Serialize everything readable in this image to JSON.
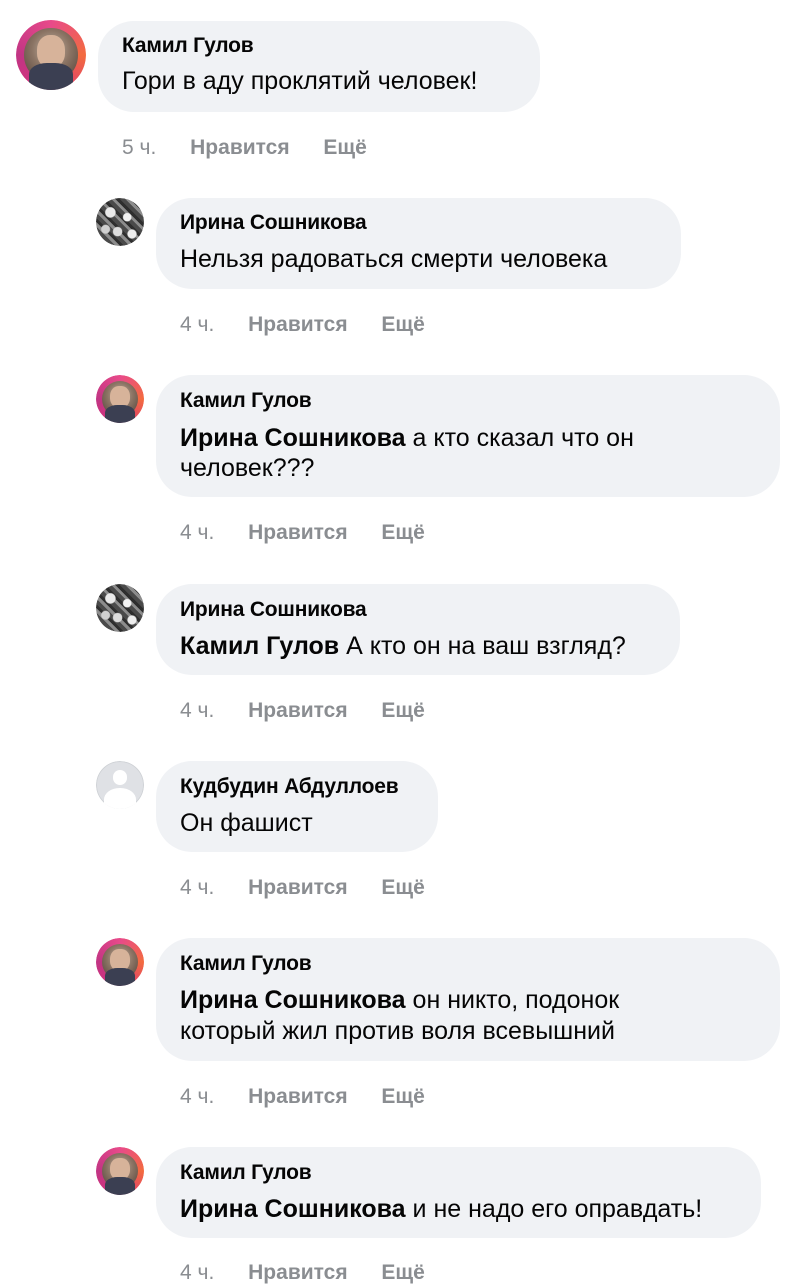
{
  "comments": [
    {
      "author": "Камил Гулов",
      "mention": "",
      "text": "Гори в аду проклятий человек!",
      "time": "5 ч.",
      "like": "Нравится",
      "more": "Ещё",
      "avatar": "kamil-avatar"
    },
    {
      "author": "Ирина Сошникова",
      "mention": "",
      "text": "Нельзя радоваться смерти человека",
      "time": "4 ч.",
      "like": "Нравится",
      "more": "Ещё",
      "avatar": "irina-avatar"
    },
    {
      "author": "Камил Гулов",
      "mention": "Ирина Сошникова",
      "text": " а кто сказал что он",
      "text2": "человек???",
      "time": "4 ч.",
      "like": "Нравится",
      "more": "Ещё",
      "avatar": "kamil-avatar"
    },
    {
      "author": "Ирина Сошникова",
      "mention": "Камил Гулов",
      "text": " А кто он на ваш взгляд?",
      "time": "4 ч.",
      "like": "Нравится",
      "more": "Ещё",
      "avatar": "irina-avatar"
    },
    {
      "author": "Кудбудин Абдуллоев",
      "mention": "",
      "text": "Он фашист",
      "time": "4 ч.",
      "like": "Нравится",
      "more": "Ещё",
      "avatar": "default-avatar"
    },
    {
      "author": "Камил Гулов",
      "mention": "Ирина Сошникова",
      "text": " он никто, подонок",
      "text2": "который жил против воля всевышний",
      "time": "4 ч.",
      "like": "Нравится",
      "more": "Ещё",
      "avatar": "kamil-avatar"
    },
    {
      "author": "Камил Гулов",
      "mention": "Ирина Сошникова",
      "text": " и не надо его оправдать!",
      "time": "4 ч.",
      "like": "Нравится",
      "more": "Ещё",
      "avatar": "kamil-avatar"
    }
  ],
  "colors": {
    "bubble": "#f0f2f5",
    "meta": "#8a8d91",
    "text": "#050505"
  }
}
